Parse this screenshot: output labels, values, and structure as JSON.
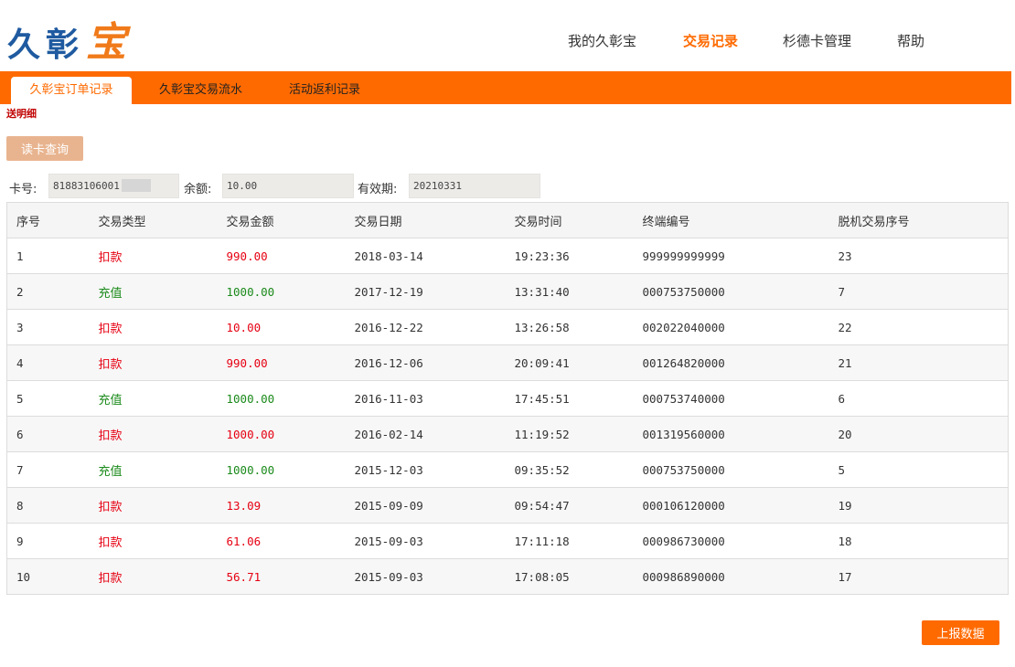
{
  "logo": {
    "part1": "久彰",
    "part2": "宝"
  },
  "topnav": {
    "items": [
      {
        "label": "我的久彰宝"
      },
      {
        "label": "交易记录"
      },
      {
        "label": "杉德卡管理"
      },
      {
        "label": "帮助"
      }
    ],
    "active": "交易记录"
  },
  "tabs": [
    {
      "label": "久彰宝订单记录"
    },
    {
      "label": "久彰宝交易流水"
    },
    {
      "label": "活动返利记录"
    }
  ],
  "sublink": "送明细",
  "read_button": "读卡查询",
  "card": {
    "card_label": "卡号:",
    "card_value": "81883106001",
    "balance_label": "余额:",
    "balance_value": "10.00",
    "expiry_label": "有效期:",
    "expiry_value": "20210331"
  },
  "table": {
    "headers": [
      "序号",
      "交易类型",
      "交易金额",
      "交易日期",
      "交易时间",
      "终端编号",
      "脱机交易序号"
    ],
    "rows": [
      [
        "1",
        "扣款",
        "990.00",
        "2018-03-14",
        "19:23:36",
        "999999999999",
        "23"
      ],
      [
        "2",
        "充值",
        "1000.00",
        "2017-12-19",
        "13:31:40",
        "000753750000",
        "7"
      ],
      [
        "3",
        "扣款",
        "10.00",
        "2016-12-22",
        "13:26:58",
        "002022040000",
        "22"
      ],
      [
        "4",
        "扣款",
        "990.00",
        "2016-12-06",
        "20:09:41",
        "001264820000",
        "21"
      ],
      [
        "5",
        "充值",
        "1000.00",
        "2016-11-03",
        "17:45:51",
        "000753740000",
        "6"
      ],
      [
        "6",
        "扣款",
        "1000.00",
        "2016-02-14",
        "11:19:52",
        "001319560000",
        "20"
      ],
      [
        "7",
        "充值",
        "1000.00",
        "2015-12-03",
        "09:35:52",
        "000753750000",
        "5"
      ],
      [
        "8",
        "扣款",
        "13.09",
        "2015-09-09",
        "09:54:47",
        "000106120000",
        "19"
      ],
      [
        "9",
        "扣款",
        "61.06",
        "2015-09-03",
        "17:11:18",
        "000986730000",
        "18"
      ],
      [
        "10",
        "扣款",
        "56.71",
        "2015-09-03",
        "17:08:05",
        "000986890000",
        "17"
      ]
    ]
  },
  "upload_button": "上报数据",
  "colors": {
    "accent": "#ff6a00",
    "debit": "#e60012",
    "credit": "#1a8a1a",
    "logo_blue": "#1f5aa0"
  }
}
